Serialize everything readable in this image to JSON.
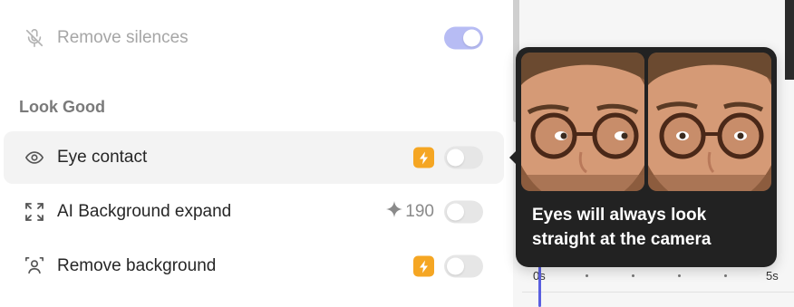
{
  "rows": [
    {
      "label": "Remove silences",
      "icon": "mic-off-icon",
      "toggle_on": true
    },
    {
      "label": "Eye contact",
      "icon": "eye-icon",
      "badge": "bolt-icon",
      "toggle_on": false
    },
    {
      "label": "AI Background expand",
      "icon": "expand-icon",
      "credits": "190",
      "credits_icon": "sparkle-icon",
      "toggle_on": false
    },
    {
      "label": "Remove background",
      "icon": "person-icon",
      "badge": "bolt-icon",
      "toggle_on": false
    }
  ],
  "section_title": "Look Good",
  "tooltip": {
    "text": "Eyes will always look straight at the camera",
    "images": [
      "eyes-looking-aside",
      "eyes-looking-at-camera"
    ]
  },
  "timeline": {
    "ticks": [
      "0s",
      "5s"
    ]
  },
  "colors": {
    "accent": "#5a5fe0",
    "toggle_on": "#b7bcf4",
    "badge": "#f5a623",
    "tooltip_bg": "#222222"
  }
}
